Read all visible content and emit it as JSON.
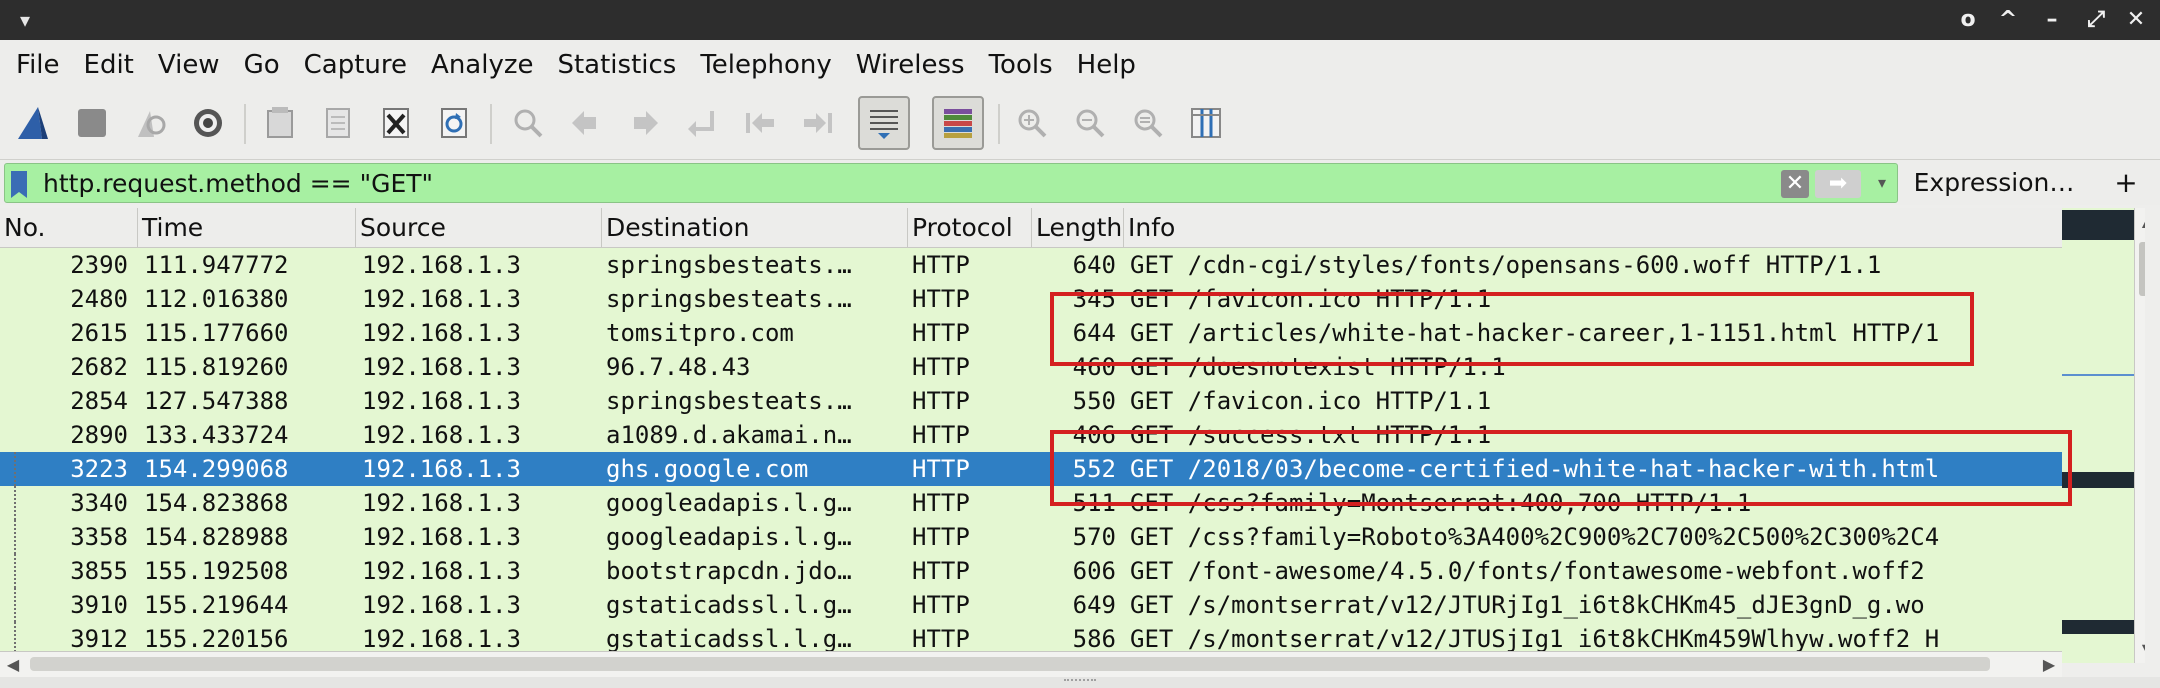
{
  "titlebar": {
    "buttons": [
      "o",
      "^",
      "–",
      "⤢",
      "✕"
    ]
  },
  "menu": [
    "File",
    "Edit",
    "View",
    "Go",
    "Capture",
    "Analyze",
    "Statistics",
    "Telephony",
    "Wireless",
    "Tools",
    "Help"
  ],
  "filter": {
    "value": "http.request.method == \"GET\"",
    "expression_label": "Expression…",
    "plus_label": "+"
  },
  "columns": [
    "No.",
    "Time",
    "Source",
    "Destination",
    "Protocol",
    "Length",
    "Info"
  ],
  "packets": [
    {
      "no": "2390",
      "time": "111.947772",
      "source": "192.168.1.3",
      "destination": "springsbesteats.…",
      "protocol": "HTTP",
      "length": "640",
      "info": "GET /cdn-cgi/styles/fonts/opensans-600.woff HTTP/1.1"
    },
    {
      "no": "2480",
      "time": "112.016380",
      "source": "192.168.1.3",
      "destination": "springsbesteats.…",
      "protocol": "HTTP",
      "length": "345",
      "info": "GET /favicon.ico HTTP/1.1"
    },
    {
      "no": "2615",
      "time": "115.177660",
      "source": "192.168.1.3",
      "destination": "tomsitpro.com",
      "protocol": "HTTP",
      "length": "644",
      "info": "GET /articles/white-hat-hacker-career,1-1151.html HTTP/1"
    },
    {
      "no": "2682",
      "time": "115.819260",
      "source": "192.168.1.3",
      "destination": "96.7.48.43",
      "protocol": "HTTP",
      "length": "460",
      "info": "GET /doesnotexist HTTP/1.1"
    },
    {
      "no": "2854",
      "time": "127.547388",
      "source": "192.168.1.3",
      "destination": "springsbesteats.…",
      "protocol": "HTTP",
      "length": "550",
      "info": "GET /favicon.ico HTTP/1.1"
    },
    {
      "no": "2890",
      "time": "133.433724",
      "source": "192.168.1.3",
      "destination": "a1089.d.akamai.n…",
      "protocol": "HTTP",
      "length": "406",
      "info": "GET /success.txt HTTP/1.1"
    },
    {
      "no": "3223",
      "time": "154.299068",
      "source": "192.168.1.3",
      "destination": "ghs.google.com",
      "protocol": "HTTP",
      "length": "552",
      "info": "GET /2018/03/become-certified-white-hat-hacker-with.html"
    },
    {
      "no": "3340",
      "time": "154.823868",
      "source": "192.168.1.3",
      "destination": "googleadapis.l.g…",
      "protocol": "HTTP",
      "length": "511",
      "info": "GET /css?family=Montserrat:400,700 HTTP/1.1"
    },
    {
      "no": "3358",
      "time": "154.828988",
      "source": "192.168.1.3",
      "destination": "googleadapis.l.g…",
      "protocol": "HTTP",
      "length": "570",
      "info": "GET /css?family=Roboto%3A400%2C900%2C700%2C500%2C300%2C4"
    },
    {
      "no": "3855",
      "time": "155.192508",
      "source": "192.168.1.3",
      "destination": "bootstrapcdn.jdo…",
      "protocol": "HTTP",
      "length": "606",
      "info": "GET /font-awesome/4.5.0/fonts/fontawesome-webfont.woff2"
    },
    {
      "no": "3910",
      "time": "155.219644",
      "source": "192.168.1.3",
      "destination": "gstaticadssl.l.g…",
      "protocol": "HTTP",
      "length": "649",
      "info": "GET /s/montserrat/v12/JTURjIg1_i6t8kCHKm45_dJE3gnD_g.wo"
    },
    {
      "no": "3912",
      "time": "155.220156",
      "source": "192.168.1.3",
      "destination": "gstaticadssl.l.g…",
      "protocol": "HTTP",
      "length": "586",
      "info": "GET /s/montserrat/v12/JTUSjIg1_i6t8kCHKm459Wlhyw.woff2 H"
    }
  ],
  "selected_packet": "3223",
  "colors": {
    "row_bg": "#e4f7d2",
    "selected_bg": "#2f7fc4",
    "filter_bg": "#a7f0a2",
    "highlight": "#d42020"
  }
}
